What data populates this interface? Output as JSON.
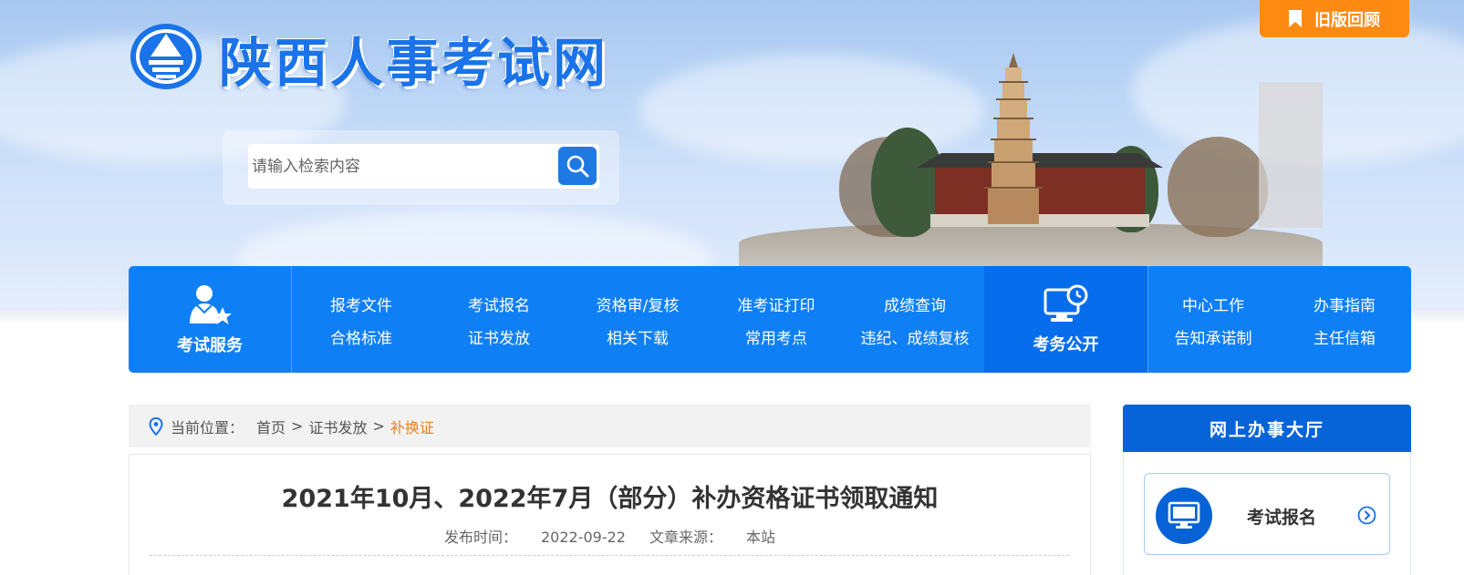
{
  "header": {
    "site_title": "陕西人事考试网",
    "old_version_label": "旧版回顾",
    "search": {
      "placeholder": "请输入检索内容"
    }
  },
  "nav": {
    "exam_services_label": "考试服务",
    "exam_services_links": [
      "报考文件",
      "考试报名",
      "资格审/复核",
      "准考证打印",
      "成绩查询",
      "合格标准",
      "证书发放",
      "相关下载",
      "常用考点",
      "违纪、成绩复核"
    ],
    "exam_affairs_label": "考务公开",
    "exam_affairs_links": [
      "中心工作",
      "办事指南",
      "告知承诺制",
      "主任信箱"
    ]
  },
  "breadcrumb": {
    "prefix": "当前位置：",
    "items": [
      "首页",
      "证书发放",
      "补换证"
    ],
    "separator": ">"
  },
  "article": {
    "title": "2021年10月、2022年7月（部分）补办资格证书领取通知",
    "publish_label": "发布时间：",
    "publish_date": "2022-09-22",
    "source_label": "文章来源：",
    "source": "本站"
  },
  "sidebar": {
    "hall_title": "网上办事大厅",
    "items": [
      {
        "label": "考试报名",
        "icon": "monitor-icon"
      }
    ]
  },
  "colors": {
    "nav_blue": "#0f7ff6",
    "nav_highlight": "#066ded",
    "accent_orange": "#ff8a12",
    "breadcrumb_current": "#ef7f1a",
    "sidebar_header": "#0663d8"
  }
}
